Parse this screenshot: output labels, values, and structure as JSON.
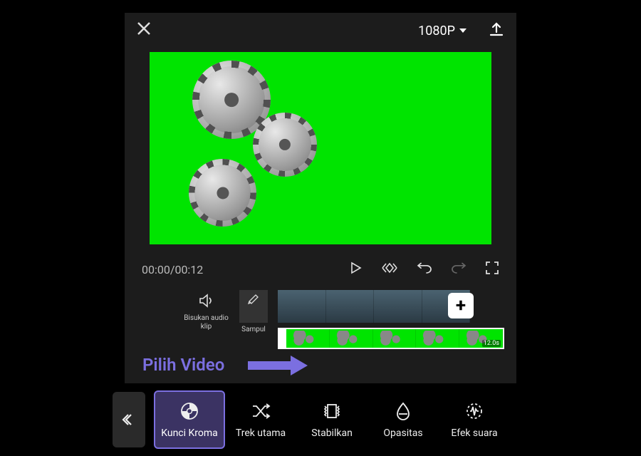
{
  "header": {
    "resolution_label": "1080P"
  },
  "playback": {
    "time_display": "00:00/00:12"
  },
  "timeline": {
    "mute_label": "Bisukan audio klip",
    "cover_label": "Sampul",
    "clip_duration": "12.0s"
  },
  "annotation": {
    "text": "Pilih Video"
  },
  "tools": {
    "chroma": "Kunci Kroma",
    "main_track": "Trek utama",
    "stabilize": "Stabilkan",
    "opacity": "Opasitas",
    "sound_fx": "Efek suara"
  },
  "colors": {
    "accent": "#7b6fe0",
    "greenscreen": "#00e400"
  }
}
